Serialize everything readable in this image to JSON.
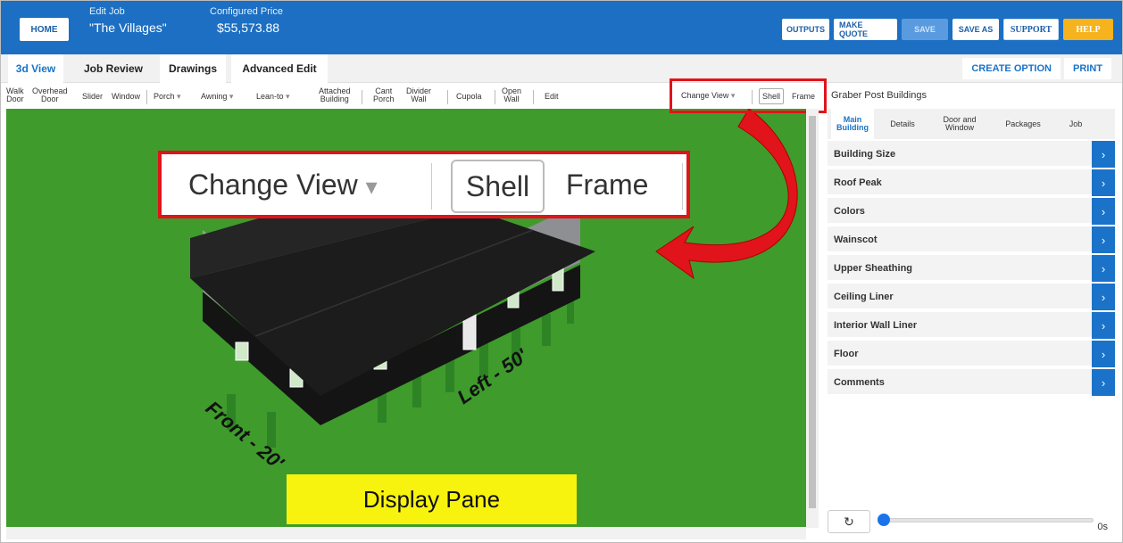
{
  "header": {
    "home_label": "HOME",
    "edit_job_label": "Edit Job",
    "job_name": "\"The Villages\"",
    "price_label": "Configured Price",
    "price_value": "$55,573.88",
    "actions": {
      "outputs": "OUTPUTS",
      "make_quote": "MAKE QUOTE",
      "save": "SAVE",
      "save_as": "SAVE AS",
      "support": "SUPPORT",
      "help": "HELP"
    }
  },
  "tabs": {
    "view3d": "3d View",
    "job_review": "Job Review",
    "drawings": "Drawings",
    "advanced_edit": "Advanced Edit",
    "create_option": "CREATE OPTION",
    "print": "PRINT"
  },
  "tools": {
    "walk_door_1": "Walk",
    "walk_door_2": "Door",
    "overhead_door_1": "Overhead",
    "overhead_door_2": "Door",
    "slider": "Slider",
    "window": "Window",
    "porch": "Porch",
    "awning": "Awning",
    "lean_to": "Lean-to",
    "attached_1": "Attached",
    "attached_2": "Building",
    "cant_1": "Cant",
    "cant_2": "Porch",
    "divider_1": "Divider",
    "divider_2": "Wall",
    "cupola": "Cupola",
    "open_1": "Open",
    "open_2": "Wall",
    "edit": "Edit",
    "change_view": "Change View",
    "shell": "Shell",
    "frame": "Frame",
    "dropdown_glyph": "▾"
  },
  "display": {
    "zoom_change_view": "Change View",
    "zoom_shell": "Shell",
    "zoom_frame": "Frame",
    "front_label": "Front - 20'",
    "left_label": "Left - 50'",
    "pane_label": "Display Pane"
  },
  "panel": {
    "title": "Graber Post Buildings",
    "tab_main_1": "Main",
    "tab_main_2": "Building",
    "tab_details": "Details",
    "tab_door_1": "Door and",
    "tab_door_2": "Window",
    "tab_packages": "Packages",
    "tab_job": "Job",
    "sections": [
      "Building Size",
      "Roof Peak",
      "Colors",
      "Wainscot",
      "Upper Sheathing",
      "Ceiling Liner",
      "Interior Wall Liner",
      "Floor",
      "Comments"
    ],
    "arrow_glyph": "›",
    "reload_glyph": "↻",
    "time": "0s"
  },
  "colors": {
    "brand_blue": "#1c6fc2",
    "grass_green": "#3f9b2c",
    "highlight_red": "#e0141a",
    "label_yellow": "#f7f30e",
    "help_orange": "#f6b31d"
  }
}
